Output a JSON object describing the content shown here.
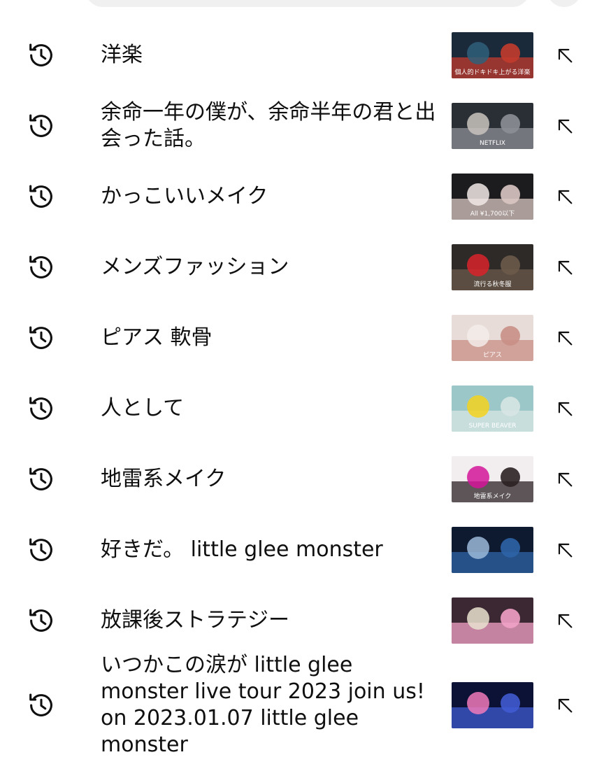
{
  "history": [
    {
      "query": "洋楽",
      "thumb": {
        "colors": [
          "#1b2a3a",
          "#c23b2e",
          "#2f5f7a"
        ],
        "caption": "個人的ドキドキ上がる洋楽"
      }
    },
    {
      "query": "余命一年の僕が、余命半年の君と出会った話。",
      "thumb": {
        "colors": [
          "#2a2f36",
          "#8c8f96",
          "#c9c3bd"
        ],
        "caption": "NETFLIX"
      }
    },
    {
      "query": "かっこいいメイク",
      "thumb": {
        "colors": [
          "#1c1c1f",
          "#d9c7c2",
          "#f1e9e6"
        ],
        "caption": "All ¥1,700以下"
      }
    },
    {
      "query": "メンズファッション",
      "thumb": {
        "colors": [
          "#2d2a28",
          "#6b5a4a",
          "#d8232a"
        ],
        "caption": "流行る秋冬服"
      }
    },
    {
      "query": "ピアス 軟骨",
      "thumb": {
        "colors": [
          "#e8dcd8",
          "#c98f86",
          "#f3ece9"
        ],
        "caption": "ピアス"
      }
    },
    {
      "query": "人として",
      "thumb": {
        "colors": [
          "#9cc7c9",
          "#d7e6e3",
          "#f3d41f"
        ],
        "caption": "SUPER BEAVER"
      }
    },
    {
      "query": "地雷系メイク",
      "thumb": {
        "colors": [
          "#f2eef0",
          "#2b2124",
          "#d3159a"
        ],
        "caption": "地雷系メイク"
      }
    },
    {
      "query": "好きだ。 little glee monster",
      "thumb": {
        "colors": [
          "#0e1a2f",
          "#2e63a7",
          "#9bb8d9"
        ],
        "caption": ""
      }
    },
    {
      "query": "放課後ストラテジー",
      "thumb": {
        "colors": [
          "#3c2832",
          "#f2a1c6",
          "#e9e2cf"
        ],
        "caption": ""
      }
    },
    {
      "query": "いつかこの涙が little glee monster live tour 2023 join us! on 2023.01.07 little glee monster",
      "thumb": {
        "colors": [
          "#0b1235",
          "#3f5bd0",
          "#f07ab9"
        ],
        "caption": ""
      }
    }
  ],
  "icons": {
    "history": "history-icon",
    "fill": "arrow-up-left-icon"
  }
}
